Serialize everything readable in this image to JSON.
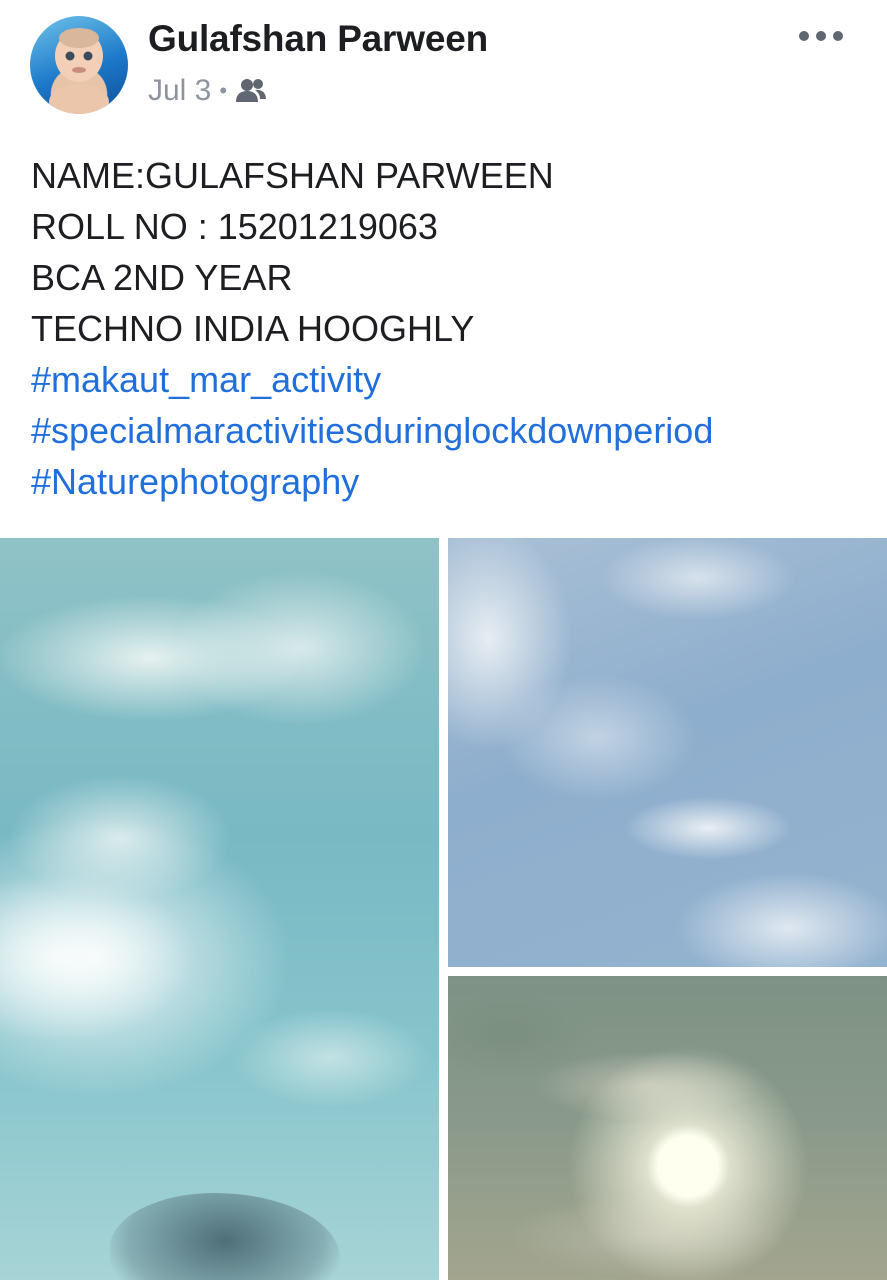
{
  "post": {
    "author": "Gulafshan Parween",
    "date": "Jul 3",
    "separator": "•",
    "audience_icon": "friends-icon",
    "menu_icon": "more-options-icon"
  },
  "text_lines": [
    "NAME:GULAFSHAN PARWEEN",
    "ROLL NO : 15201219063",
    "BCA 2ND YEAR",
    "TECHNO INDIA HOOGHLY"
  ],
  "hashtags": [
    "#makaut_mar_activity",
    "#specialmaractivitiesduringlockdownperiod",
    "#Naturephotography"
  ],
  "colors": {
    "hashtag": "#216fdb",
    "text": "#1c1e21",
    "meta": "#8d949e"
  }
}
